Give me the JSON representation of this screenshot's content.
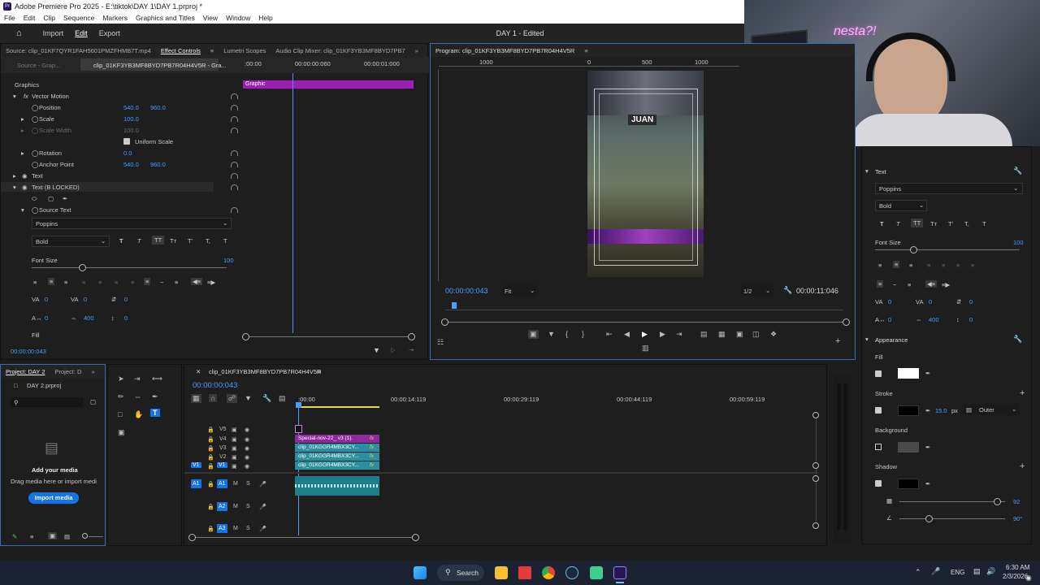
{
  "app": {
    "title": "Adobe Premiere Pro 2025 - E:\\tiktok\\DAY 1\\DAY 1.prproj *",
    "logo": "Pr",
    "menu": [
      "File",
      "Edit",
      "Clip",
      "Sequence",
      "Markers",
      "Graphics and Titles",
      "View",
      "Window",
      "Help"
    ],
    "nav": [
      "Import",
      "Edit",
      "Export"
    ],
    "project_title": "DAY 1 - Edited"
  },
  "source_panel": {
    "tabs": [
      "Source: clip_01KF7QYR1FAH5601PMZFHMB7T.mp4",
      "Effect Controls",
      "Lumetri Scopes",
      "Audio Clip Mixer: clip_01KF3YB3MF8BYD7PB7"
    ],
    "source_tab": "Source - Grap...",
    "clip_tab": "clip_01KF3YB3MF8BYD7PB7R04H4V5R - Gra...",
    "time_start": ":00:00",
    "time_mid": "00:00:00:060",
    "time_end": "00:00:01:000",
    "graphic_bar_label": "Graphic",
    "timecode": "00:00:00:043"
  },
  "effect_controls": {
    "section": "Graphics",
    "vector_motion": "Vector Motion",
    "position_label": "Position",
    "position_x": "540.0",
    "position_y": "960.0",
    "scale_label": "Scale",
    "scale": "100.0",
    "scale_width_label": "Scale Width",
    "scale_width": "100.0",
    "uniform_scale": "Uniform Scale",
    "rotation_label": "Rotation",
    "rotation": "0.0",
    "anchor_label": "Anchor Point",
    "anchor_x": "540.0",
    "anchor_y": "960.0",
    "text_label": "Text",
    "text_locked_label": "Text (B LOCKED)",
    "source_text": "Source Text",
    "font": "Poppins",
    "style": "Bold",
    "font_size_label": "Font Size",
    "font_size": "100",
    "tracking_a": "0",
    "tracking_b": "0",
    "leading": "0",
    "kerning": "400",
    "baseline": "0",
    "tsume": "0",
    "fill_label": "Fill"
  },
  "program": {
    "tab": "Program: clip_01KF3YB3MF8BYD7PB7R04H4V5R",
    "ruler_left": "1000",
    "ruler_zero": "0",
    "ruler_500": "500",
    "ruler_1000": "1000",
    "overlay_name": "JUAN",
    "timecode": "00:00:00:043",
    "fit": "Fit",
    "resolution": "1/2",
    "duration": "00:00:11:046",
    "stream_watermark": "nesta?!"
  },
  "project_panel": {
    "tabs": [
      "Project: DAY 2",
      "Project: D"
    ],
    "file": "DAY 2.prproj",
    "add_media_title": "Add your media",
    "add_media_sub": "Drag media here or import medi",
    "import_button": "Import media"
  },
  "timeline": {
    "sequence_name": "clip_01KF3YB3MF8BYD7PB7R04H4V5R",
    "timecode": "00:00:00:043",
    "ruler": [
      ":00:00",
      "00:00:14:119",
      "00:00:29:119",
      "00:00:44:119",
      "00:00:59:119"
    ],
    "video_tracks": [
      "V5",
      "V4",
      "V3",
      "V2",
      "V1"
    ],
    "audio_tracks": [
      "A1",
      "A2",
      "A3"
    ],
    "source_v1": "V1",
    "source_a1": "A1",
    "clips": {
      "v4": "Special-nov-22_ v3 (1).",
      "v3": "clip_01KGGR4MBX3CY...",
      "v2": "clip_01KGGR4MBX3CY...",
      "v1": "clip_01KGGR4MBX3CY..."
    },
    "fx": "fx",
    "m": "M",
    "s": "S"
  },
  "essential_graphics": {
    "text_section": "Text",
    "font": "Poppins",
    "style": "Bold",
    "font_size_label": "Font Size",
    "font_size": "100",
    "tracking_a": "0",
    "tracking_b": "0",
    "leading": "0",
    "kerning": "400",
    "baseline": "0",
    "tsume": "0",
    "appearance": "Appearance",
    "fill": "Fill",
    "stroke": "Stroke",
    "stroke_value": "15.0",
    "stroke_unit": "px",
    "stroke_type": "Outer",
    "background": "Background",
    "shadow": "Shadow",
    "shadow_opacity": "92",
    "shadow_angle": "90°",
    "fill_color": "#ffffff",
    "stroke_color": "#000000"
  },
  "taskbar": {
    "search": "Search",
    "lang": "ENG",
    "time": "6:30 AM",
    "date": "2/3/2026"
  },
  "colors": {
    "accent": "#4a9df8",
    "graphic_bar": "#9b1fb5",
    "video_clip": "#2a8f9e",
    "graphic_clip": "#8e2a9e",
    "audio_clip": "#1f7c8a"
  }
}
